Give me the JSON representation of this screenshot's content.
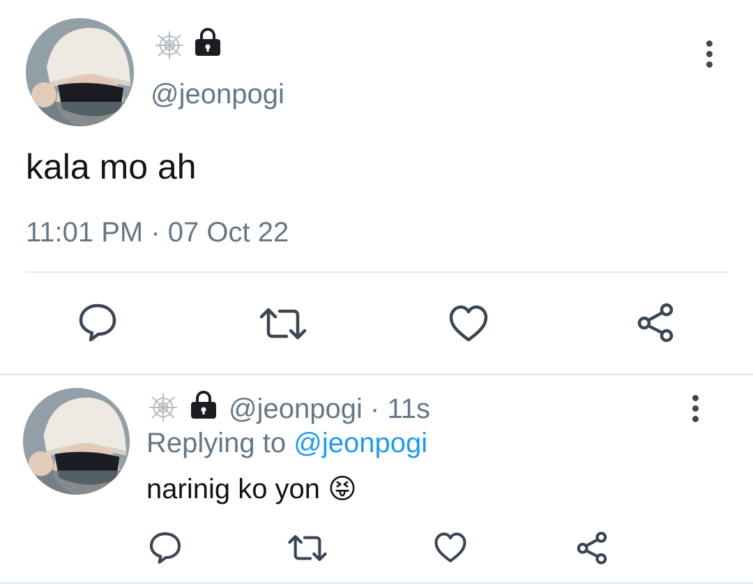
{
  "main_tweet": {
    "handle": "@jeonpogi",
    "text": "kala mo ah",
    "timestamp": "11:01 PM · 07 Oct 22",
    "badge_icons": [
      "spiderweb-icon",
      "lock-icon"
    ]
  },
  "actions": {
    "reply": "speech-bubble-icon",
    "retweet": "retweet-icon",
    "like": "heart-icon",
    "share": "share-icon"
  },
  "reply_tweet": {
    "handle": "@jeonpogi",
    "separator": "·",
    "time_ago": "11s",
    "replying_prefix": "Replying to",
    "replying_handle": "@jeonpogi",
    "text": "narinig ko yon",
    "emoji": "😝"
  },
  "colors": {
    "text": "#0f1419",
    "muted": "#657786",
    "link": "#1d9bf0",
    "divider": "#e6ecf0"
  }
}
